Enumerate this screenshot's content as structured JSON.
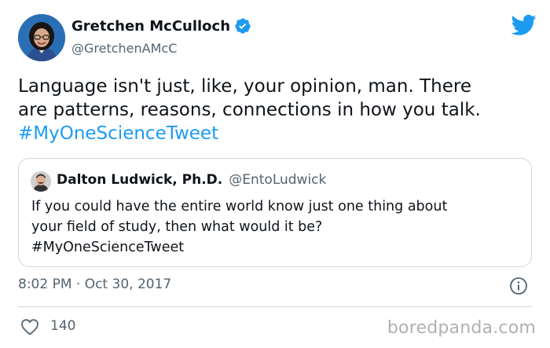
{
  "tweet": {
    "author": {
      "name": "Gretchen McCulloch",
      "handle": "@GretchenAMcC",
      "verified": true,
      "avatar_icon": "user-avatar-photo"
    },
    "platform_icon": "twitter-bird-icon",
    "text_lines": [
      "Language isn't just, like, your opinion, man. There",
      "are patterns, reasons, connections in how you talk."
    ],
    "hashtag": "#MyOneScienceTweet",
    "timestamp": "8:02 PM · Oct 30, 2017",
    "likes": "140",
    "accent_color": "#1d9bf0"
  },
  "quoted_tweet": {
    "author": {
      "name": "Dalton Ludwick, Ph.D.",
      "handle": "@EntoLudwick",
      "avatar_icon": "user-avatar-photo"
    },
    "text_lines": [
      "If you could have the entire world know just one thing about",
      "your field of study, then what would it be?",
      "#MyOneScienceTweet"
    ]
  },
  "watermark": "boredpanda.com"
}
